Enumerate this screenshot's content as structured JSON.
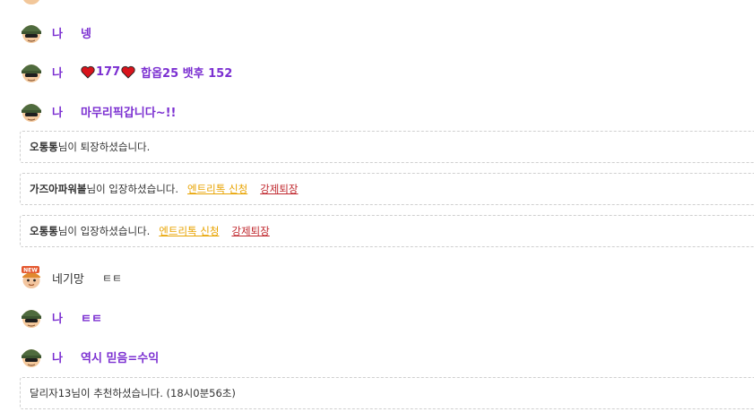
{
  "messages": [
    {
      "sender": "나",
      "text": "넹"
    },
    {
      "sender": "나",
      "count": "177",
      "text": "합옵25 뱃후 152"
    },
    {
      "sender": "나",
      "text": "마무리픽갑니다~!!"
    },
    {
      "sender": "네기망",
      "text": "ㅌㅌ"
    },
    {
      "sender": "나",
      "text": "ㅌㅌ"
    },
    {
      "sender": "나",
      "text": "역시 믿음=수익"
    }
  ],
  "notices": [
    {
      "name": "오통통",
      "text": "님이 퇴장하셨습니다."
    },
    {
      "name": "가즈아파워볼",
      "text": "님이 입장하셨습니다.",
      "entry_link": "엔트리톡 신청",
      "kick_link": "강제퇴장"
    },
    {
      "name": "오통통",
      "text": "님이 입장하셨습니다.",
      "entry_link": "엔트리톡 신청",
      "kick_link": "강제퇴장"
    },
    {
      "text": "달리자13님이 추천하셨습니다. (18시0분56초)"
    }
  ],
  "avatars": {
    "soldier": "soldier-avatar-icon",
    "new_badge_label": "NEW"
  },
  "colors": {
    "my_text": "#7b2fd1",
    "other_text": "#333333",
    "entry_link": "#e8a300",
    "kick_link": "#c0282e",
    "border": "#cfcfcf"
  }
}
